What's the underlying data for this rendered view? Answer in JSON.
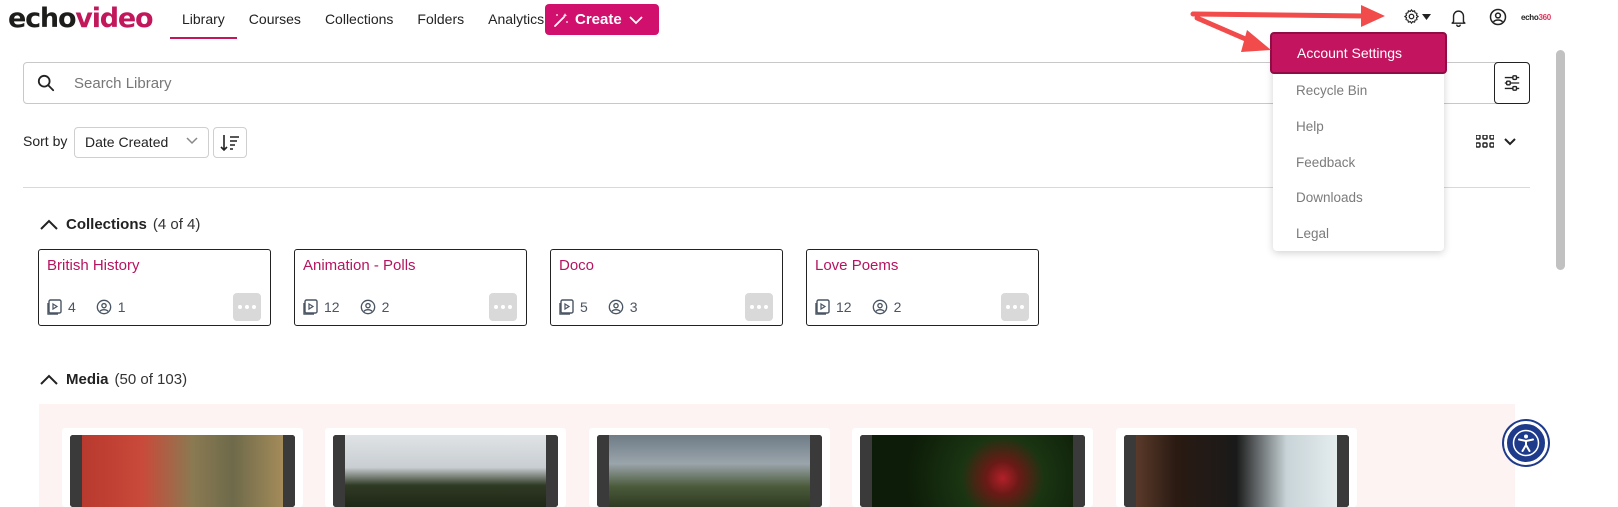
{
  "header": {
    "logo_echo": "echo",
    "logo_video": "video",
    "nav": [
      {
        "label": "Library",
        "active": true
      },
      {
        "label": "Courses",
        "active": false
      },
      {
        "label": "Collections",
        "active": false
      },
      {
        "label": "Folders",
        "active": false
      },
      {
        "label": "Analytics",
        "active": false
      }
    ],
    "create_label": "Create",
    "brand_small_a": "echo",
    "brand_small_b": "360",
    "icons": [
      "gear-icon",
      "bell-icon",
      "user-icon"
    ]
  },
  "search": {
    "placeholder": "Search Library",
    "value": ""
  },
  "sort": {
    "label": "Sort by",
    "selected": "Date Created"
  },
  "collections": {
    "title": "Collections",
    "count": "(4 of 4)",
    "items": [
      {
        "name": "British History",
        "media": "4",
        "users": "1"
      },
      {
        "name": "Animation - Polls",
        "media": "12",
        "users": "2"
      },
      {
        "name": "Doco",
        "media": "5",
        "users": "3"
      },
      {
        "name": "Love Poems",
        "media": "12",
        "users": "2"
      }
    ]
  },
  "media": {
    "title": "Media",
    "count": "(50 of 103)"
  },
  "settings_menu": {
    "items": [
      "Account Settings",
      "Recycle Bin",
      "Help",
      "Feedback",
      "Downloads",
      "Legal"
    ],
    "highlighted": "Account Settings"
  },
  "colors": {
    "brand": "#c2185b",
    "accent_button": "#d0106c",
    "annotation_arrow": "#f24b4b",
    "accessibility": "#1e3a8a"
  }
}
